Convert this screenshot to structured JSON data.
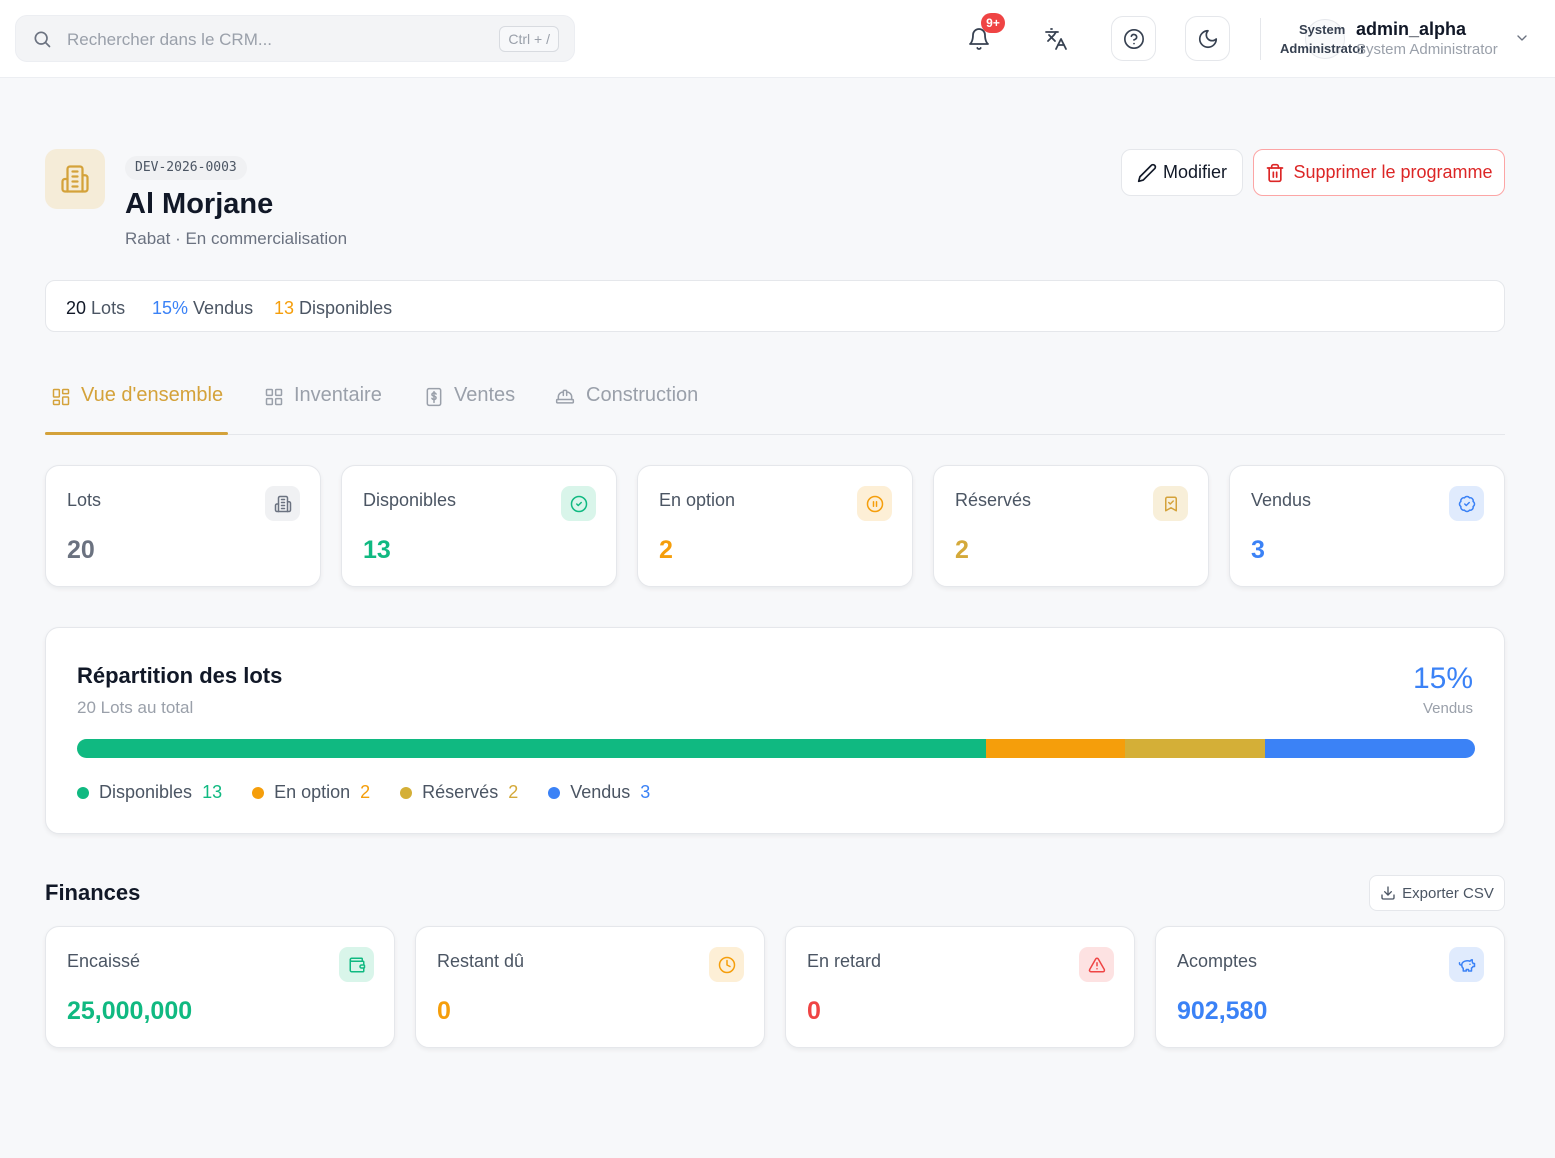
{
  "topbar": {
    "search_placeholder": "Rechercher dans le CRM...",
    "search_shortcut": "Ctrl + /",
    "notifications_badge": "9+",
    "user": {
      "avatar_line1": "System",
      "avatar_line2": "Administrator",
      "name": "admin_alpha",
      "role": "System Administrator"
    }
  },
  "program": {
    "reference": "DEV-2026-0003",
    "name": "Al Morjane",
    "subtitle": "Rabat · En commercialisation",
    "edit_label": "Modifier",
    "delete_label": "Supprimer le programme"
  },
  "summary": {
    "lots_value": "20",
    "lots_label": "Lots",
    "sold_value": "15%",
    "sold_label": "Vendus",
    "available_value": "13",
    "available_label": "Disponibles"
  },
  "tabs": [
    {
      "label": "Vue d'ensemble",
      "icon": "grid-icon",
      "active": true
    },
    {
      "label": "Inventaire",
      "icon": "grid-icon",
      "active": false
    },
    {
      "label": "Ventes",
      "icon": "receipt-dollar-icon",
      "active": false
    },
    {
      "label": "Construction",
      "icon": "hard-hat-icon",
      "active": false
    }
  ],
  "stats": [
    {
      "label": "Lots",
      "value": "20",
      "color": "#6b7280",
      "icon": "building-icon"
    },
    {
      "label": "Disponibles",
      "value": "13",
      "color": "#10b981",
      "icon": "check-circle-icon"
    },
    {
      "label": "En option",
      "value": "2",
      "color": "#f59e0b",
      "icon": "pause-circle-icon"
    },
    {
      "label": "Réservés",
      "value": "2",
      "color": "#d4a93a",
      "icon": "bookmark-check-icon"
    },
    {
      "label": "Vendus",
      "value": "3",
      "color": "#3b82f6",
      "icon": "badge-check-icon"
    }
  ],
  "repartition": {
    "title": "Répartition des lots",
    "subtitle": "20 Lots au total",
    "sold_pct": "15%",
    "sold_label": "Vendus",
    "total": 20,
    "segments": [
      {
        "label": "Disponibles",
        "count": 13,
        "color": "#10b981"
      },
      {
        "label": "En option",
        "count": 2,
        "color": "#f59e0b"
      },
      {
        "label": "Réservés",
        "count": 2,
        "color": "#d4af37"
      },
      {
        "label": "Vendus",
        "count": 3,
        "color": "#3b82f6"
      }
    ]
  },
  "finances": {
    "title": "Finances",
    "export_label": "Exporter CSV",
    "cards": [
      {
        "label": "Encaissé",
        "value": "25,000,000",
        "color": "#10b981",
        "icon": "wallet-icon"
      },
      {
        "label": "Restant dû",
        "value": "0",
        "color": "#f59e0b",
        "icon": "clock-icon"
      },
      {
        "label": "En retard",
        "value": "0",
        "color": "#ef4444",
        "icon": "warning-icon"
      },
      {
        "label": "Acomptes",
        "value": "902,580",
        "color": "#3b82f6",
        "icon": "piggy-bank-icon"
      }
    ]
  }
}
